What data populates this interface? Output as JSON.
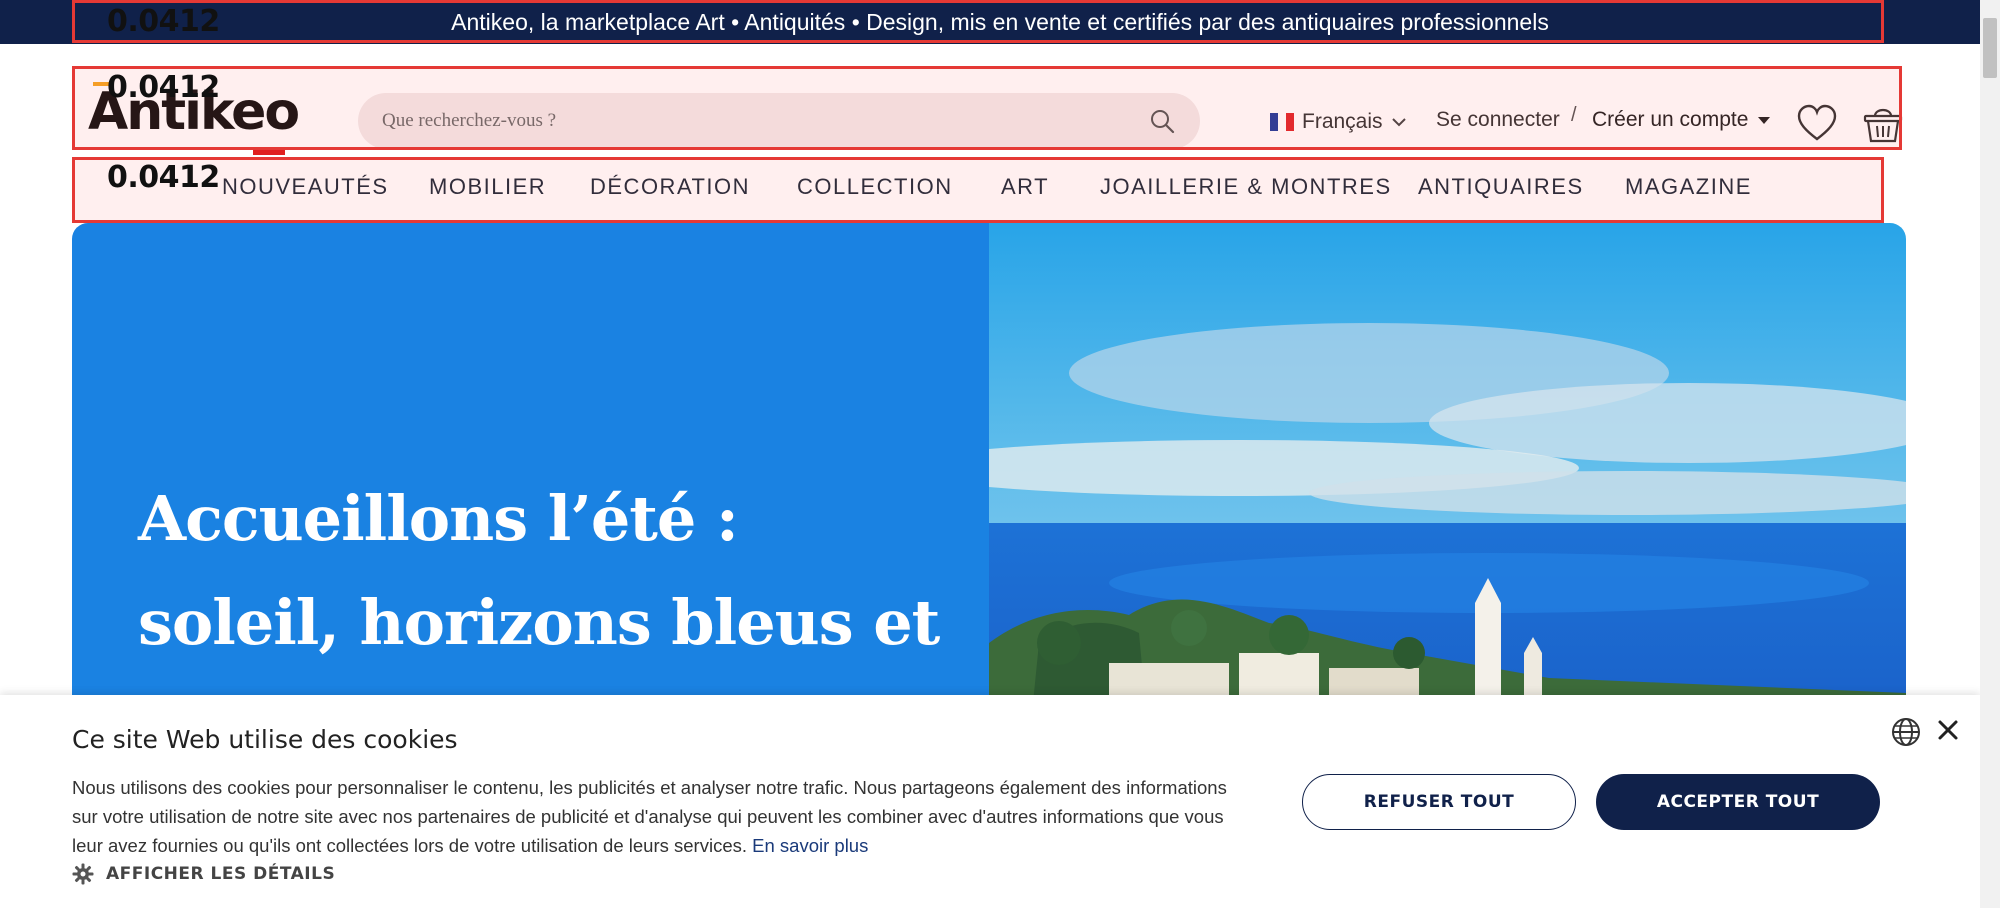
{
  "announcement": {
    "text": "Antikeo, la marketplace Art • Antiquités • Design, mis en vente et certifiés par des antiquaires professionnels"
  },
  "overlay_tags": [
    "0.0412",
    "0.0412",
    "0.0412"
  ],
  "header": {
    "logo": "Antikeo",
    "search": {
      "placeholder": "Que recherchez-vous ?"
    },
    "language": "Français",
    "login": "Se connecter",
    "separator": "/",
    "create_account": "Créer un compte",
    "icons": [
      "search-icon",
      "heart-icon",
      "basket-icon",
      "chevron-down-icon"
    ]
  },
  "nav": {
    "items": [
      "NOUVEAUTÉS",
      "MOBILIER",
      "DÉCORATION",
      "COLLECTION",
      "ART",
      "JOAILLERIE & MONTRES",
      "ANTIQUAIRES",
      "MAGAZINE"
    ]
  },
  "hero": {
    "title": "Accueillons l’été : soleil, horizons bleus et art de",
    "bg_color": "#1a82e2"
  },
  "cookie": {
    "title": "Ce site Web utilise des cookies",
    "body": "Nous utilisons des cookies pour personnaliser le contenu, les publicités et analyser notre trafic. Nous partageons également des informations sur votre utilisation de notre site avec nos partenaires de publicité et d'analyse qui peuvent les combiner avec d'autres informations que vous leur avez fournies ou qu'ils ont collectées lors de votre utilisation de leurs services.",
    "learn_more": "En savoir plus",
    "details": "AFFICHER LES DÉTAILS",
    "refuse": "REFUSER TOUT",
    "accept": "ACCEPTER TOUT"
  },
  "colors": {
    "navy": "#10214a",
    "hero_blue": "#1a82e2",
    "highlight_red": "#e53935"
  }
}
